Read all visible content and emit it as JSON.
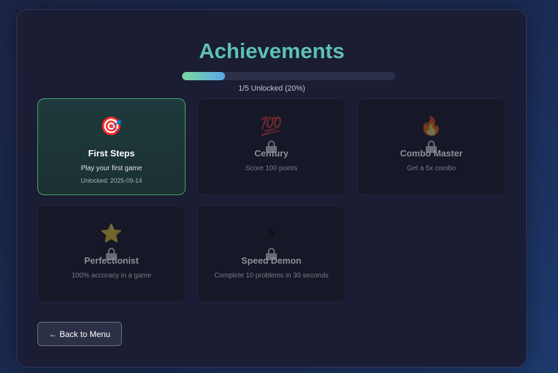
{
  "header": {
    "title": "Achievements"
  },
  "progress": {
    "fraction": 0.2,
    "text": "1/5 Unlocked (20%)"
  },
  "achievements": [
    {
      "icon": "🎯",
      "icon_name": "target-icon",
      "name": "First Steps",
      "desc": "Play your first game",
      "unlocked": true,
      "date": "Unlocked: 2025-09-14"
    },
    {
      "icon": "💯",
      "icon_name": "hundred-points-icon",
      "name": "Century",
      "desc": "Score 100 points",
      "unlocked": false
    },
    {
      "icon": "🔥",
      "icon_name": "fire-icon",
      "name": "Combo Master",
      "desc": "Get a 5x combo",
      "unlocked": false
    },
    {
      "icon": "⭐",
      "icon_name": "star-icon",
      "name": "Perfectionist",
      "desc": "100% accuracy in a game",
      "unlocked": false
    },
    {
      "icon": "⚡",
      "icon_name": "lightning-icon",
      "name": "Speed Demon",
      "desc": "Complete 10 problems in 30 seconds",
      "unlocked": false
    }
  ],
  "footer": {
    "back_label": "← Back to Menu"
  }
}
